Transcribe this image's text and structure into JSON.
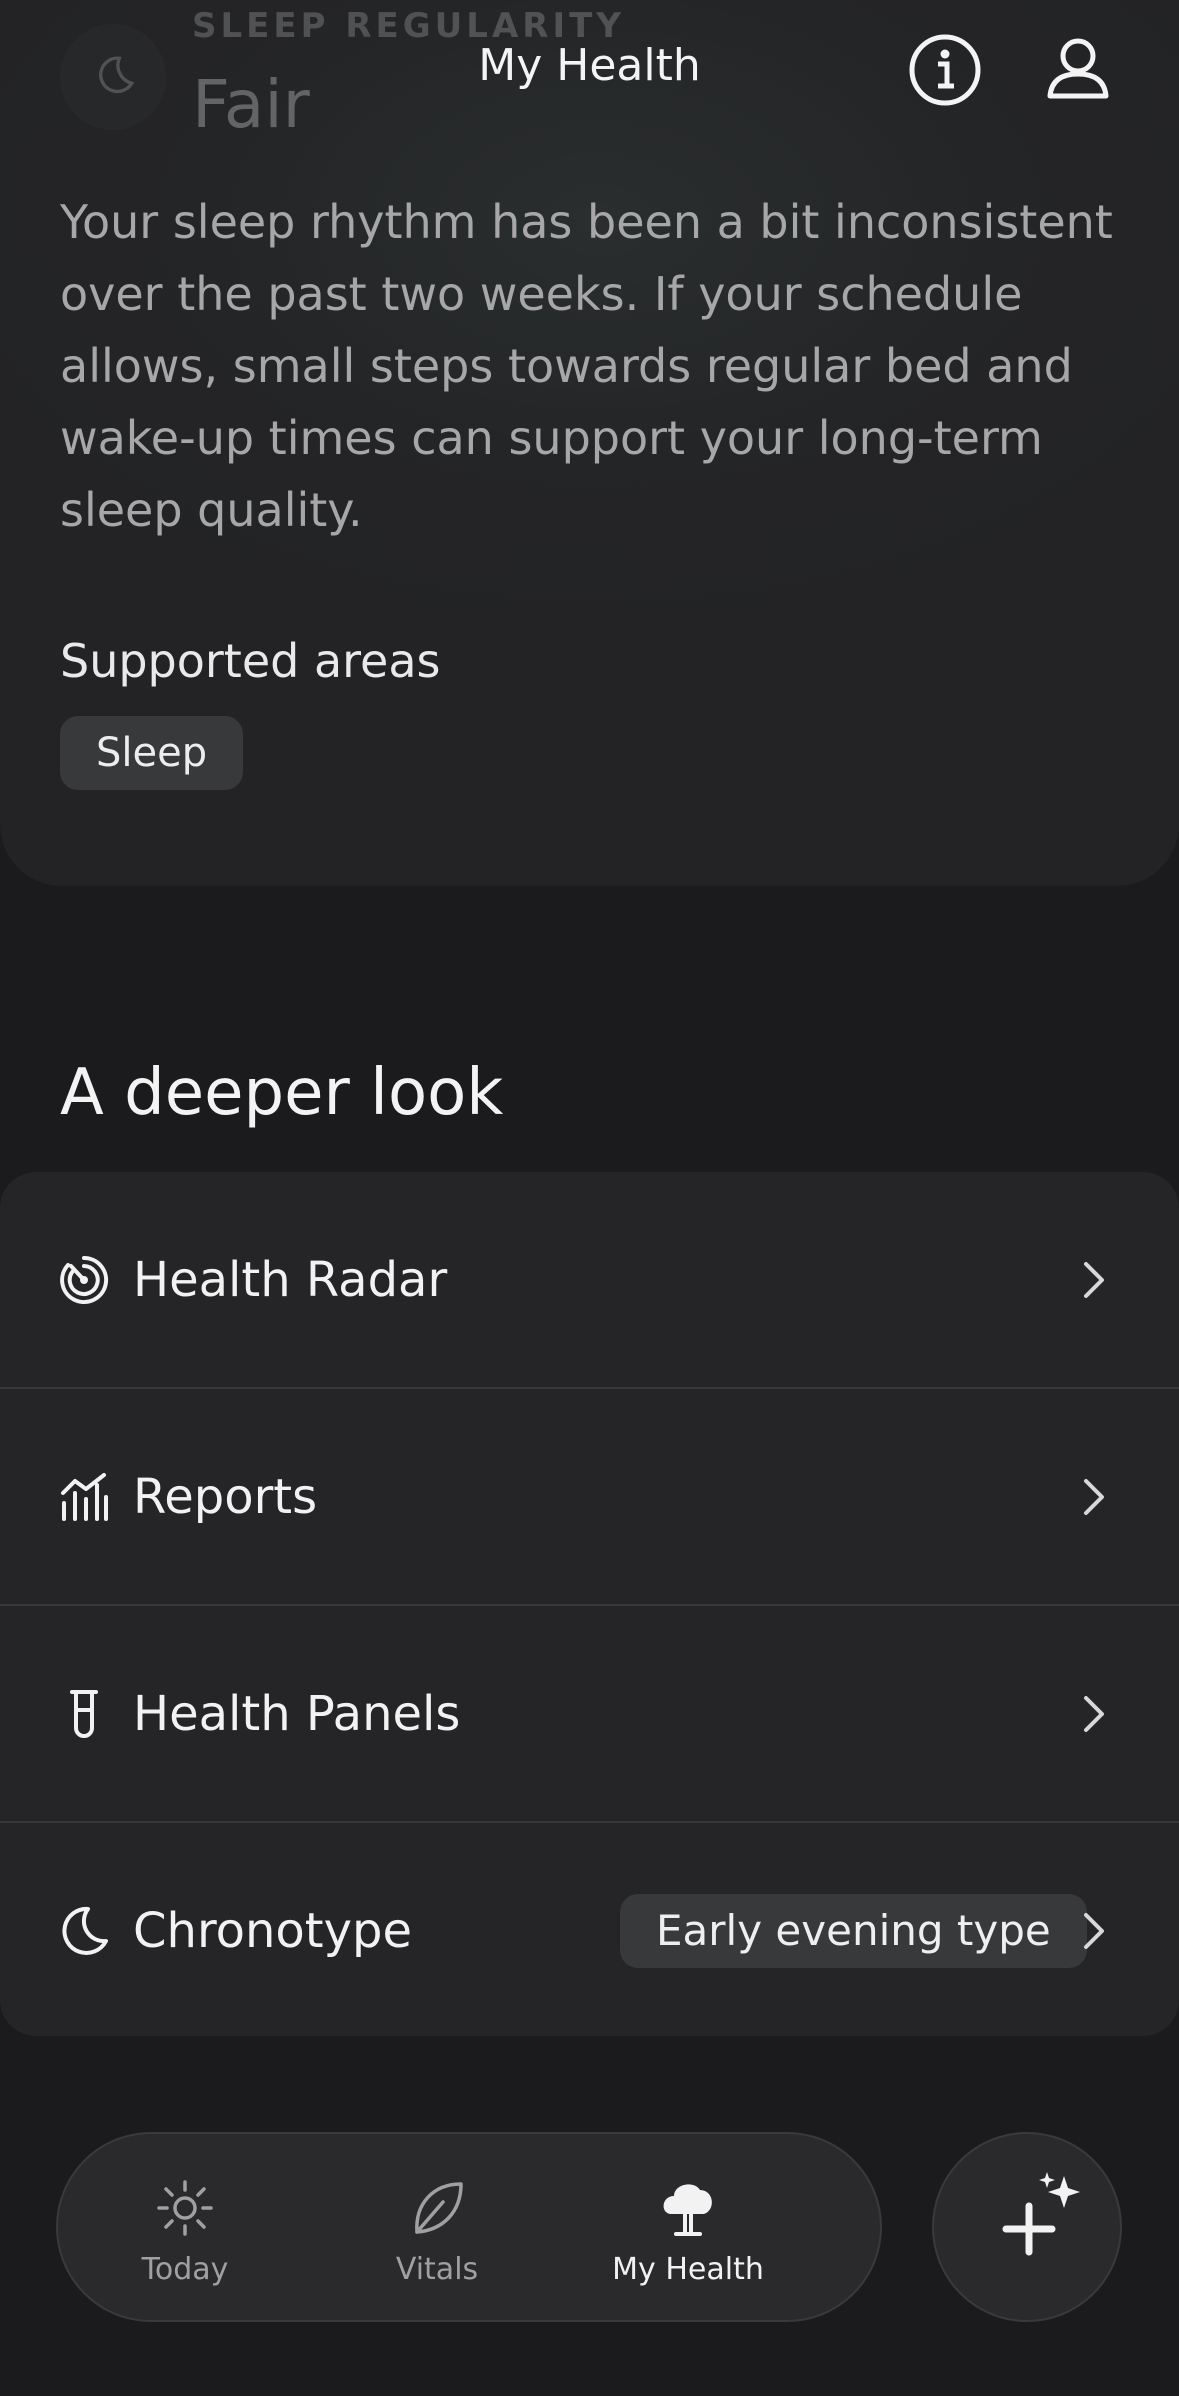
{
  "header": {
    "title": "My Health"
  },
  "sleep_card": {
    "label": "SLEEP REGULARITY",
    "value": "Fair",
    "description": "Your sleep rhythm has been a bit inconsistent over the past two weeks. If your schedule allows, small steps towards regular bed and wake-up times can support your long-term sleep quality.",
    "supported_label": "Supported areas",
    "chips": [
      "Sleep"
    ]
  },
  "section_title": "A deeper look",
  "list": {
    "items": [
      {
        "label": "Health Radar",
        "icon": "radar-icon"
      },
      {
        "label": "Reports",
        "icon": "chart-icon"
      },
      {
        "label": "Health Panels",
        "icon": "test-tube-icon"
      },
      {
        "label": "Chronotype",
        "icon": "moon-icon",
        "badge": "Early evening type"
      }
    ]
  },
  "tabbar": {
    "tabs": [
      {
        "label": "Today",
        "icon": "sun-icon",
        "active": false
      },
      {
        "label": "Vitals",
        "icon": "leaf-icon",
        "active": false
      },
      {
        "label": "My Health",
        "icon": "tree-icon",
        "active": true
      }
    ]
  },
  "fab": {
    "icon": "plus-sparkle-icon"
  }
}
